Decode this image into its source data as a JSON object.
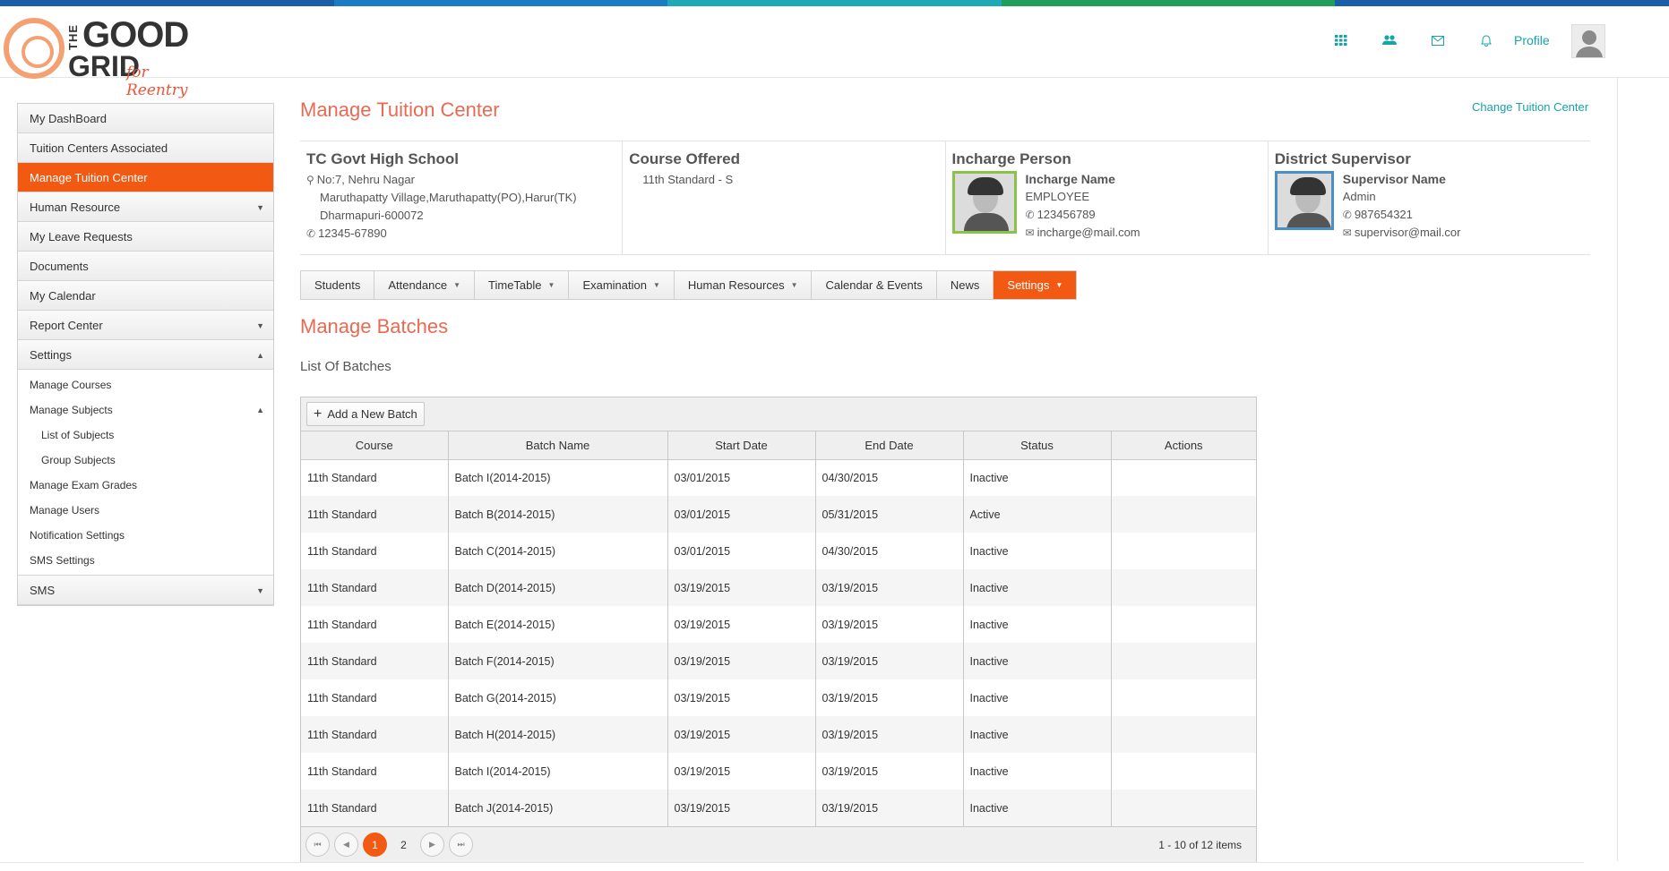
{
  "colors": {
    "accent": "#f25a14",
    "teal": "#17a3a8",
    "title": "#e86a52",
    "stripe": [
      "#1b5fa8",
      "#1a7cc4",
      "#1fa9b8",
      "#1f9e5c",
      "#1b5fa8"
    ]
  },
  "logo": {
    "the": "THE",
    "good": "GOOD",
    "grid": "GRID",
    "tagline": "for Reentry"
  },
  "header": {
    "icons": [
      "apps-grid-icon",
      "users-icon",
      "mail-icon",
      "bell-icon"
    ],
    "profile_label": "Profile"
  },
  "sidebar": {
    "items": [
      {
        "label": "My DashBoard"
      },
      {
        "label": "Tuition Centers Associated"
      },
      {
        "label": "Manage Tuition Center"
      },
      {
        "label": "Human Resource"
      },
      {
        "label": "My Leave Requests"
      },
      {
        "label": "Documents"
      },
      {
        "label": "My Calendar"
      },
      {
        "label": "Report Center"
      },
      {
        "label": "Settings"
      }
    ],
    "settings_sub": [
      {
        "label": "Manage Courses"
      },
      {
        "label": "Manage Subjects"
      },
      {
        "label": "List of Subjects"
      },
      {
        "label": "Group Subjects"
      },
      {
        "label": "Manage Exam Grades"
      },
      {
        "label": "Manage Users"
      },
      {
        "label": "Notification Settings"
      },
      {
        "label": "SMS Settings"
      }
    ],
    "sms": "SMS"
  },
  "page": {
    "title": "Manage Tuition Center",
    "change_link": "Change Tuition Center"
  },
  "center": {
    "name": "TC Govt High School",
    "address1": "No:7, Nehru Nagar",
    "address2": "Maruthapatty Village,Maruthapatty(PO),Harur(TK)",
    "address3": "Dharmapuri-600072",
    "phone": "12345-67890"
  },
  "course": {
    "heading": "Course Offered",
    "value": "11th Standard - S"
  },
  "incharge": {
    "heading": "Incharge Person",
    "name": "Incharge Name",
    "role": "EMPLOYEE",
    "phone": "123456789",
    "email": "incharge@mail.com"
  },
  "supervisor": {
    "heading": "District Supervisor",
    "name": "Supervisor Name",
    "role": "Admin",
    "phone": "987654321",
    "email": "supervisor@mail.cor"
  },
  "tabs": [
    "Students",
    "Attendance",
    "TimeTable",
    "Examination",
    "Human Resources",
    "Calendar & Events",
    "News",
    "Settings"
  ],
  "section": {
    "title": "Manage Batches",
    "subtitle": "List Of Batches",
    "add_button": "Add a New Batch"
  },
  "table": {
    "headers": [
      "Course",
      "Batch Name",
      "Start Date",
      "End Date",
      "Status",
      "Actions"
    ],
    "rows": [
      [
        "11th Standard",
        "Batch I(2014-2015)",
        "03/01/2015",
        "04/30/2015",
        "Inactive",
        ""
      ],
      [
        "11th Standard",
        "Batch B(2014-2015)",
        "03/01/2015",
        "05/31/2015",
        "Active",
        ""
      ],
      [
        "11th Standard",
        "Batch C(2014-2015)",
        "03/01/2015",
        "04/30/2015",
        "Inactive",
        ""
      ],
      [
        "11th Standard",
        "Batch D(2014-2015)",
        "03/19/2015",
        "03/19/2015",
        "Inactive",
        ""
      ],
      [
        "11th Standard",
        "Batch E(2014-2015)",
        "03/19/2015",
        "03/19/2015",
        "Inactive",
        ""
      ],
      [
        "11th Standard",
        "Batch F(2014-2015)",
        "03/19/2015",
        "03/19/2015",
        "Inactive",
        ""
      ],
      [
        "11th Standard",
        "Batch G(2014-2015)",
        "03/19/2015",
        "03/19/2015",
        "Inactive",
        ""
      ],
      [
        "11th Standard",
        "Batch H(2014-2015)",
        "03/19/2015",
        "03/19/2015",
        "Inactive",
        ""
      ],
      [
        "11th Standard",
        "Batch I(2014-2015)",
        "03/19/2015",
        "03/19/2015",
        "Inactive",
        ""
      ],
      [
        "11th Standard",
        "Batch J(2014-2015)",
        "03/19/2015",
        "03/19/2015",
        "Inactive",
        ""
      ]
    ]
  },
  "pager": {
    "pages": [
      "1",
      "2"
    ],
    "current": "1",
    "info": "1 - 10 of 12 items"
  }
}
